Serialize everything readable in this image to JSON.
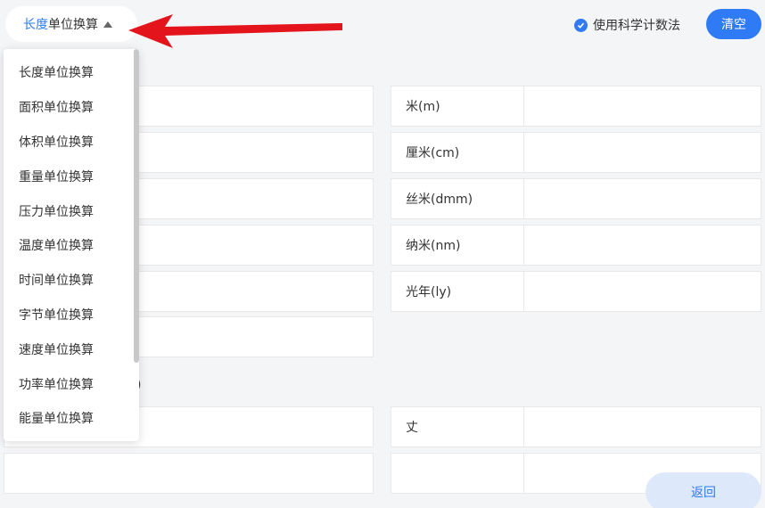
{
  "header": {
    "selector_highlight": "长度",
    "selector_rest": "单位换算",
    "sci_notation_label": "使用科学计数法",
    "sci_notation_checked": true,
    "clear_label": "清空"
  },
  "dropdown": {
    "items": [
      "长度单位换算",
      "面积单位换算",
      "体积单位换算",
      "重量单位换算",
      "压力单位换算",
      "温度单位换算",
      "时间单位换算",
      "字节单位换算",
      "速度单位换算",
      "功率单位换算",
      "能量单位换算"
    ]
  },
  "metric_units": [
    "米(m)",
    "厘米(cm)",
    "丝米(dmm)",
    "纳米(nm)",
    "光年(ly)"
  ],
  "section_suffix": ")",
  "chinese_units": [
    "丈"
  ],
  "footer": {
    "return_label": "返回"
  },
  "colors": {
    "accent": "#2f7bf5",
    "arrow": "#e3141b"
  }
}
